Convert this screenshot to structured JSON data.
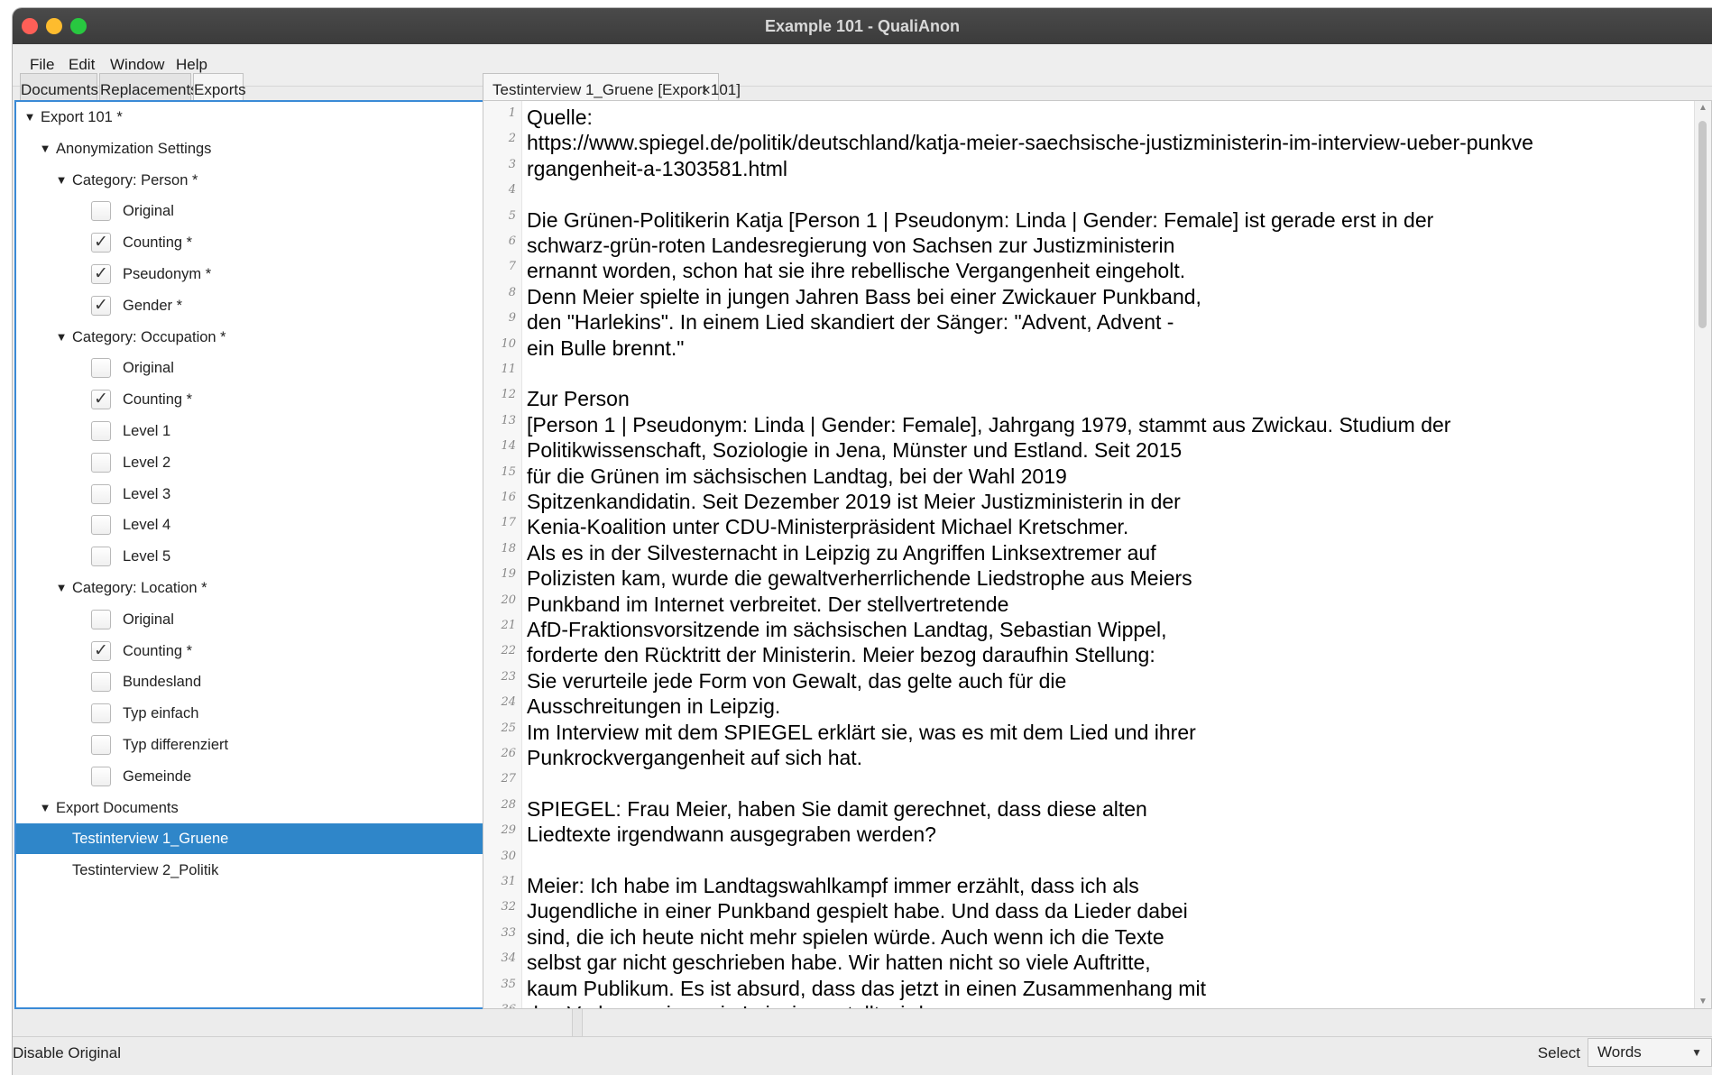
{
  "window": {
    "title": "Example 101 - QualiAnon"
  },
  "menubar": {
    "items": [
      "File",
      "Edit",
      "Window",
      "Help"
    ]
  },
  "left_tabs": [
    "Documents",
    "Replacements",
    "Exports"
  ],
  "tree": {
    "root": "Export 101 *",
    "settings": "Anonymization Settings",
    "person": {
      "label": "Category: Person *",
      "items": [
        {
          "label": "Original",
          "checked": false
        },
        {
          "label": "Counting *",
          "checked": true
        },
        {
          "label": "Pseudonym *",
          "checked": true
        },
        {
          "label": "Gender *",
          "checked": true
        }
      ]
    },
    "occupation": {
      "label": "Category: Occupation *",
      "items": [
        {
          "label": "Original",
          "checked": false
        },
        {
          "label": "Counting *",
          "checked": true
        },
        {
          "label": "Level 1",
          "checked": false
        },
        {
          "label": "Level 2",
          "checked": false
        },
        {
          "label": "Level 3",
          "checked": false
        },
        {
          "label": "Level 4",
          "checked": false
        },
        {
          "label": "Level 5",
          "checked": false
        }
      ]
    },
    "location": {
      "label": "Category: Location *",
      "items": [
        {
          "label": "Original",
          "checked": false
        },
        {
          "label": "Counting *",
          "checked": true
        },
        {
          "label": "Bundesland",
          "checked": false
        },
        {
          "label": "Typ einfach",
          "checked": false
        },
        {
          "label": "Typ differenziert",
          "checked": false
        },
        {
          "label": "Gemeinde",
          "checked": false
        }
      ]
    },
    "export_docs": {
      "label": "Export Documents",
      "items": [
        "Testinterview 1_Gruene",
        "Testinterview 2_Politik"
      ],
      "selected": "Testinterview 1_Gruene"
    }
  },
  "doc_tab": {
    "label": "Testinterview 1_Gruene [Export 101]",
    "close": "×"
  },
  "editor": {
    "lines": [
      "Quelle:",
      "https://www.spiegel.de/politik/deutschland/katja-meier-saechsische-justizministerin-im-interview-ueber-punkve",
      "rgangenheit-a-1303581.html",
      "",
      "Die Grünen-Politikerin Katja [Person 1 | Pseudonym: Linda | Gender: Female] ist gerade erst in der",
      "schwarz-grün-roten Landesregierung von Sachsen zur Justizministerin",
      "ernannt worden, schon hat sie ihre rebellische Vergangenheit eingeholt.",
      "Denn Meier spielte in jungen Jahren Bass bei einer Zwickauer Punkband,",
      "den \"Harlekins\". In einem Lied skandiert der Sänger: \"Advent, Advent -",
      "ein Bulle brennt.\"",
      "",
      "Zur Person",
      "[Person 1 | Pseudonym: Linda | Gender: Female], Jahrgang 1979, stammt aus Zwickau. Studium der",
      "Politikwissenschaft, Soziologie in Jena, Münster und Estland. Seit 2015",
      "für die Grünen im sächsischen Landtag, bei der Wahl 2019",
      "Spitzenkandidatin. Seit Dezember 2019 ist Meier Justizministerin in der",
      "Kenia-Koalition unter CDU-Ministerpräsident Michael Kretschmer.",
      "Als es in der Silvesternacht in Leipzig zu Angriffen Linksextremer auf",
      "Polizisten kam, wurde die gewaltverherrlichende Liedstrophe aus Meiers",
      "Punkband im Internet verbreitet. Der stellvertretende",
      "AfD-Fraktionsvorsitzende im sächsischen Landtag, Sebastian Wippel,",
      "forderte den Rücktritt der Ministerin. Meier bezog daraufhin Stellung:",
      "Sie verurteile jede Form von Gewalt, das gelte auch für die",
      "Ausschreitungen in Leipzig.",
      "Im Interview mit dem SPIEGEL erklärt sie, was es mit dem Lied und ihrer",
      "Punkrockvergangenheit auf sich hat.",
      "",
      "SPIEGEL: Frau Meier, haben Sie damit gerechnet, dass diese alten",
      "Liedtexte irgendwann ausgegraben werden?",
      "",
      "Meier: Ich habe im Landtagswahlkampf immer erzählt, dass ich als",
      "Jugendliche in einer Punkband gespielt habe. Und dass da Lieder dabei",
      "sind, die ich heute nicht mehr spielen würde. Auch wenn ich die Texte",
      "selbst gar nicht geschrieben habe. Wir hatten nicht so viele Auftritte,",
      "kaum Publikum. Es ist absurd, dass das jetzt in einen Zusammenhang mit",
      "den Vorkommnissen in Leipzig gestellt wird."
    ]
  },
  "statusbar": {
    "text": "Disable Original",
    "select_label": "Select",
    "select_value": "Words"
  },
  "colors": {
    "selection": "#2f86c9",
    "focus_border": "#3a8ad6"
  }
}
